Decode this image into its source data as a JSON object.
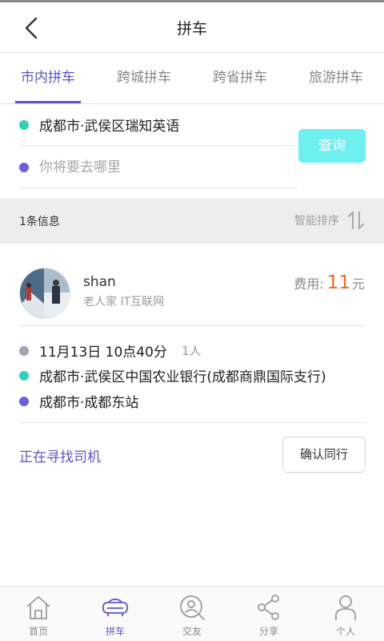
{
  "header": {
    "title": "拼车",
    "back_icon": "chevron-left-icon"
  },
  "tabs": [
    {
      "label": "市内拼车",
      "active": true
    },
    {
      "label": "跨城拼车",
      "active": false
    },
    {
      "label": "跨省拼车",
      "active": false
    },
    {
      "label": "旅游拼车",
      "active": false
    }
  ],
  "search": {
    "from": "成都市·武侯区瑞知英语",
    "to_value": "",
    "to_placeholder": "你将要去哪里",
    "query_label": "查询"
  },
  "results": {
    "count_text": "1条信息",
    "sort_label": "智能排序",
    "sort_icon": "sort-arrows-icon"
  },
  "card": {
    "user_name": "shan",
    "user_tag": "老人家 IT互联网",
    "fee_label": "费用:",
    "fee_amount": "11",
    "fee_unit": "元",
    "datetime": "11月13日 10点40分",
    "persons": "1人",
    "origin": "成都市·武侯区中国农业银行(成都商鼎国际支行)",
    "destination": "成都市·成都东站",
    "status": "正在寻找司机",
    "confirm_label": "确认同行"
  },
  "bottom_nav": [
    {
      "label": "首页",
      "icon": "home-icon",
      "active": false
    },
    {
      "label": "拼车",
      "icon": "car-icon",
      "active": true
    },
    {
      "label": "交友",
      "icon": "person-search-icon",
      "active": false
    },
    {
      "label": "分享",
      "icon": "share-icon",
      "active": false
    },
    {
      "label": "个人",
      "icon": "user-icon",
      "active": false
    }
  ],
  "colors": {
    "accent": "#5b55c9",
    "query_button": "#6ef0f0",
    "fee": "#f26522",
    "origin_dot": "#2ed3b6",
    "destination_dot": "#6b5de0"
  }
}
